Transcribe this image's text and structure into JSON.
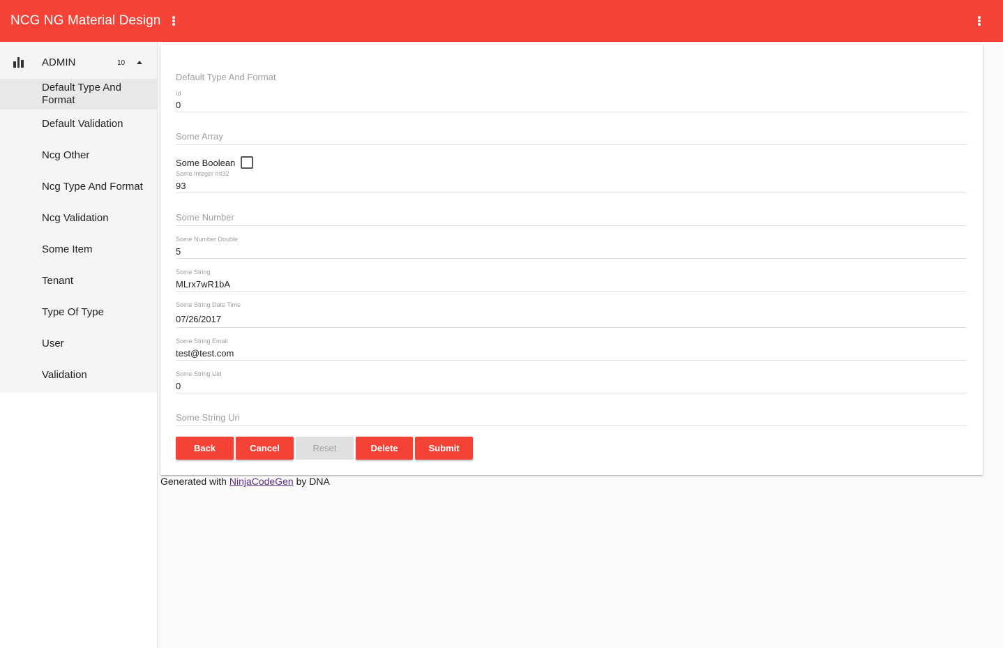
{
  "app": {
    "title": "NCG NG Material Design",
    "colors": {
      "primary": "#f44336",
      "sidebar": "#f5f5f5",
      "active_item": "#e8e8e8",
      "link": "#5b2c83"
    }
  },
  "sidebar": {
    "header": {
      "label": "ADMIN",
      "count": "10",
      "icon": "bar-chart-icon"
    },
    "items": [
      {
        "label": "Default Type And Format",
        "active": true
      },
      {
        "label": "Default Validation"
      },
      {
        "label": "Ncg Other"
      },
      {
        "label": "Ncg Type And Format"
      },
      {
        "label": "Ncg Validation"
      },
      {
        "label": "Some Item"
      },
      {
        "label": "Tenant"
      },
      {
        "label": "Type Of Type"
      },
      {
        "label": "User"
      },
      {
        "label": "Validation"
      }
    ]
  },
  "form": {
    "title": "Default Type And Format",
    "id": {
      "label": "Id",
      "value": "0"
    },
    "some_array": {
      "placeholder": "Some Array"
    },
    "some_boolean": {
      "label": "Some Boolean"
    },
    "some_integer": {
      "label": "Some Integer Int32",
      "value": "93"
    },
    "some_number": {
      "placeholder": "Some Number"
    },
    "some_number_double": {
      "label": "Some Number Double",
      "value": "5"
    },
    "some_string": {
      "label": "Some String",
      "value": "MLrx7wR1bA"
    },
    "some_string_date_time": {
      "label": "Some String Date Time",
      "value": "07/26/2017"
    },
    "some_string_email": {
      "label": "Some String Email",
      "value": "test@test.com"
    },
    "some_string_uid": {
      "label": "Some String Uid",
      "value": "0"
    },
    "some_string_uri": {
      "placeholder": "Some String Uri"
    },
    "buttons": {
      "back": "Back",
      "cancel": "Cancel",
      "reset": "Reset",
      "delete": "Delete",
      "submit": "Submit"
    }
  },
  "footer": {
    "prefix": "Generated with",
    "link": "NinjaCodeGen",
    "suffix": "by DNA"
  }
}
